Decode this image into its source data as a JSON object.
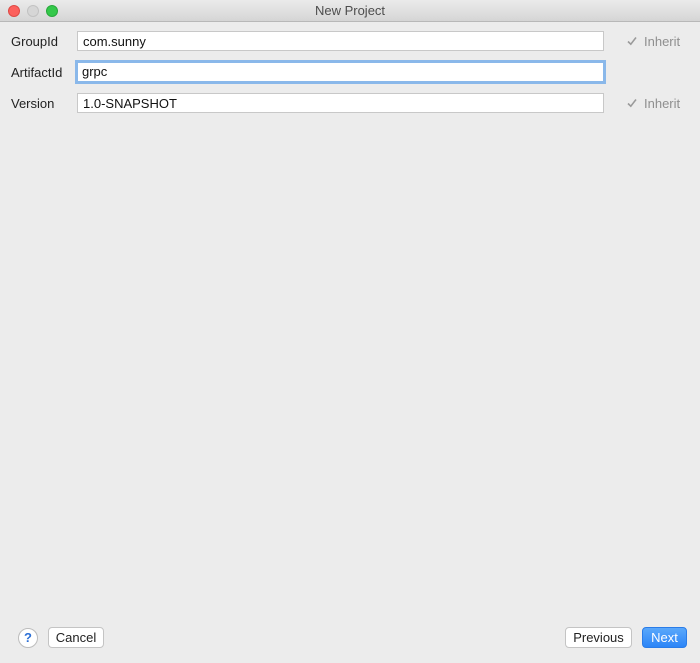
{
  "window": {
    "title": "New Project"
  },
  "form": {
    "group_id": {
      "label": "GroupId",
      "value": "com.sunny",
      "inherit_label": "Inherit",
      "inherit_checked": true
    },
    "artifact_id": {
      "label": "ArtifactId",
      "value": "grpc",
      "focused": true
    },
    "version": {
      "label": "Version",
      "value": "1.0-SNAPSHOT",
      "inherit_label": "Inherit",
      "inherit_checked": true
    }
  },
  "footer": {
    "help_label": "?",
    "cancel_label": "Cancel",
    "previous_label": "Previous",
    "next_label": "Next"
  },
  "colors": {
    "background": "#ececec",
    "focus_ring": "#8ab8ea",
    "primary_button": "#2c85f7",
    "traffic_close": "#fc605c",
    "traffic_minimize": "#d6d6d6",
    "traffic_zoom": "#34c84a"
  }
}
